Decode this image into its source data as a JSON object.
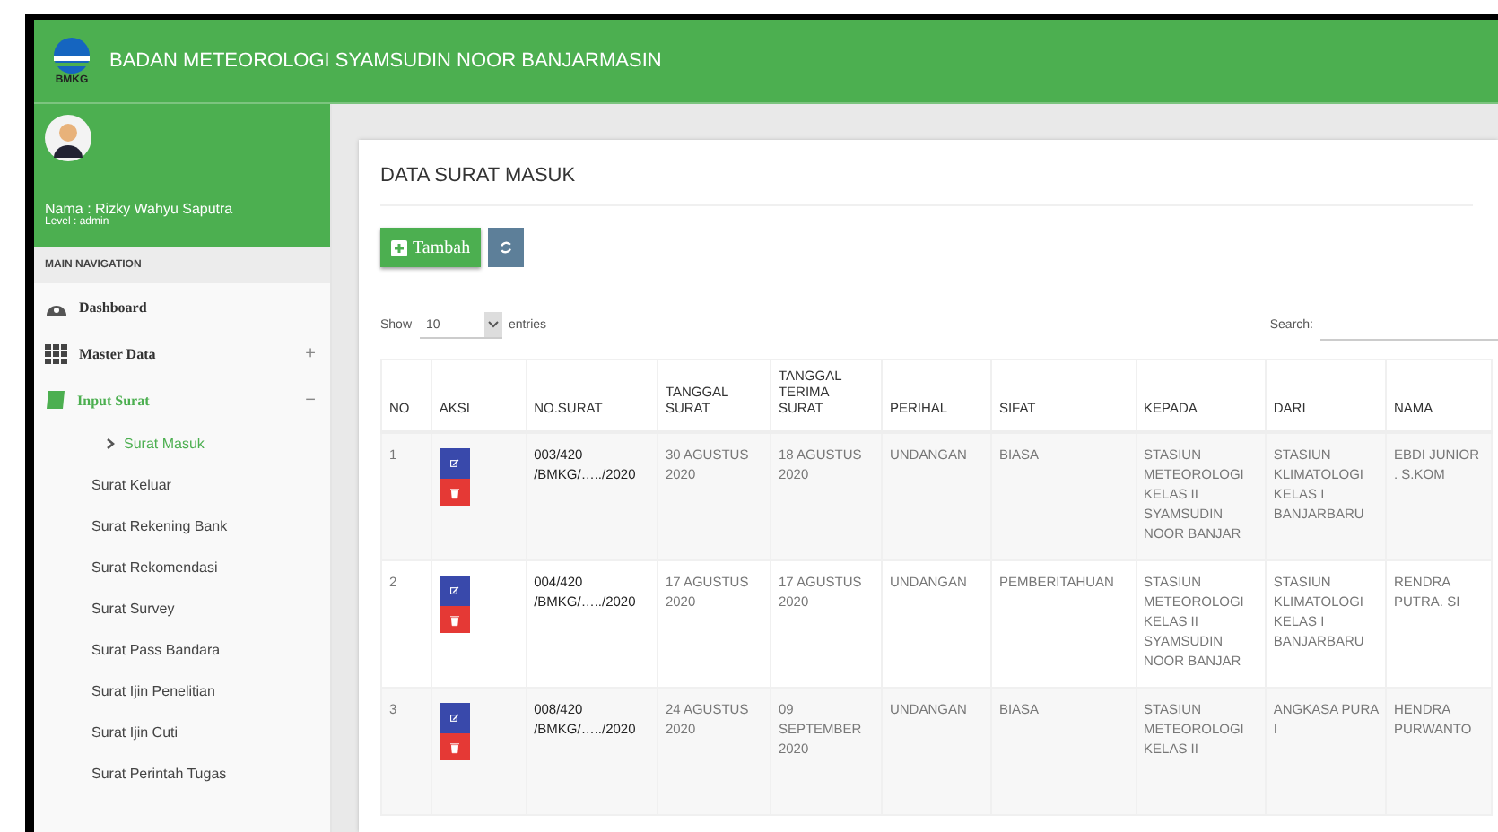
{
  "header": {
    "logo_text": "BMKG",
    "title": "BADAN METEOROLOGI SYAMSUDIN NOOR BANJARMASIN"
  },
  "user": {
    "name": "Nama : Rizky Wahyu Saputra",
    "level": "Level : admin"
  },
  "sidebar": {
    "heading": "MAIN NAVIGATION",
    "items": [
      {
        "kind": "dashboard",
        "label": "Dashboard"
      },
      {
        "kind": "grid",
        "label": "Master Data",
        "expanded": false,
        "toggle": "+"
      },
      {
        "kind": "book",
        "label": "Input Surat",
        "expanded": true,
        "toggle": "−",
        "children": [
          {
            "label": "Surat Masuk",
            "selected": true
          },
          {
            "label": "Surat Keluar",
            "selected": false
          },
          {
            "label": "Surat Rekening Bank",
            "selected": false
          },
          {
            "label": "Surat Rekomendasi",
            "selected": false
          },
          {
            "label": "Surat Survey",
            "selected": false
          },
          {
            "label": "Surat Pass Bandara",
            "selected": false
          },
          {
            "label": "Surat Ijin Penelitian",
            "selected": false
          },
          {
            "label": "Surat Ijin Cuti",
            "selected": false
          },
          {
            "label": "Surat Perintah Tugas",
            "selected": false
          }
        ]
      }
    ]
  },
  "card": {
    "title": "DATA SURAT MASUK",
    "add_button": "Tambah",
    "show_label": "Show",
    "entries_value": "10",
    "entries_label": "entries",
    "search_label": "Search:"
  },
  "table": {
    "columns": [
      "NO",
      "AKSI",
      "NO.SURAT",
      "TANGGAL SURAT",
      "TANGGAL TERIMA SURAT",
      "PERIHAL",
      "SIFAT",
      "KEPADA",
      "DARI",
      "NAMA"
    ],
    "rows": [
      {
        "no": "1",
        "no_surat": "003/420\n/BMKG/…../2020",
        "tanggal_surat": "30 AGUSTUS 2020",
        "tanggal_terima": "18 AGUSTUS 2020",
        "perihal": "UNDANGAN",
        "sifat": "BIASA",
        "kepada": "STASIUN METEOROLOGI KELAS II SYAMSUDIN NOOR BANJAR",
        "dari": "STASIUN KLIMATOLOGI KELAS I BANJARBARU",
        "nama": "EBDI JUNIOR . S.KOM"
      },
      {
        "no": "2",
        "no_surat": "004/420\n/BMKG/…../2020",
        "tanggal_surat": "17 AGUSTUS 2020",
        "tanggal_terima": "17 AGUSTUS 2020",
        "perihal": "UNDANGAN",
        "sifat": "PEMBERITAHUAN",
        "kepada": "STASIUN METEOROLOGI KELAS II SYAMSUDIN NOOR BANJAR",
        "dari": "STASIUN KLIMATOLOGI KELAS I BANJARBARU",
        "nama": "RENDRA PUTRA. SI"
      },
      {
        "no": "3",
        "no_surat": "008/420\n/BMKG/…../2020",
        "tanggal_surat": "24 AGUSTUS 2020",
        "tanggal_terima": "09 SEPTEMBER 2020",
        "perihal": "UNDANGAN",
        "sifat": "BIASA",
        "kepada": "STASIUN METEOROLOGI KELAS II",
        "dari": "ANGKASA PURA I",
        "nama": "HENDRA PURWANTO"
      }
    ]
  }
}
